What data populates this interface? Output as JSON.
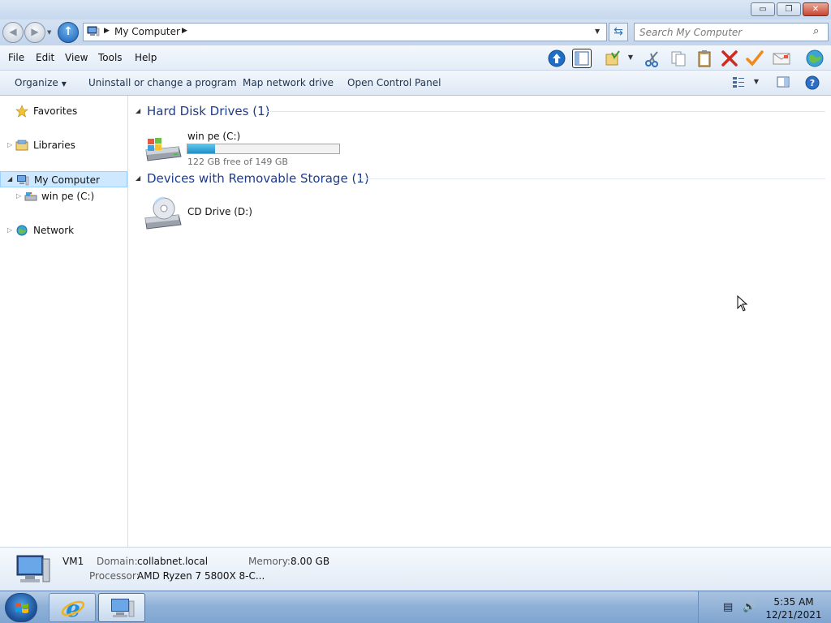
{
  "window": {
    "caption_buttons": {
      "minimize": "▭",
      "restore": "❐",
      "close": "✕"
    }
  },
  "address": {
    "path_label": "My Computer",
    "search_placeholder": "Search My Computer"
  },
  "menu": {
    "items": [
      "File",
      "Edit",
      "View",
      "Tools",
      "Help"
    ],
    "toolbar_icons": [
      "up-icon",
      "preview-pane-icon",
      "properties-folder-icon",
      "cut-icon",
      "copy-icon",
      "paste-icon",
      "delete-icon",
      "select-icon",
      "mail-icon",
      "globe-icon"
    ]
  },
  "command_bar": {
    "organize": "Organize",
    "uninstall": "Uninstall or change a program",
    "map_drive": "Map network drive",
    "control_panel": "Open Control Panel"
  },
  "nav": {
    "favorites": "Favorites",
    "libraries": "Libraries",
    "my_computer": "My Computer",
    "win_pe": "win pe (C:)",
    "network": "Network"
  },
  "content": {
    "group_hdd": "Hard Disk Drives (1)",
    "group_removable": "Devices with Removable Storage (1)",
    "drive_c": {
      "name": "win pe (C:)",
      "free_text": "122 GB free of 149 GB",
      "used_fraction": 0.181
    },
    "drive_d": {
      "name": "CD Drive (D:)"
    }
  },
  "details": {
    "computer_name": "VM1",
    "domain_label": "Domain:",
    "domain_value": "collabnet.local",
    "memory_label": "Memory:",
    "memory_value": "8.00 GB",
    "processor_label": "Processor:",
    "processor_value": "AMD Ryzen 7 5800X 8-C..."
  },
  "taskbar": {
    "time": "5:35 AM",
    "date": "12/21/2021"
  },
  "colors": {
    "group_title": "#1e3c8c",
    "selection": "#cde8ff",
    "usage_bar": "#1f8fc7"
  }
}
